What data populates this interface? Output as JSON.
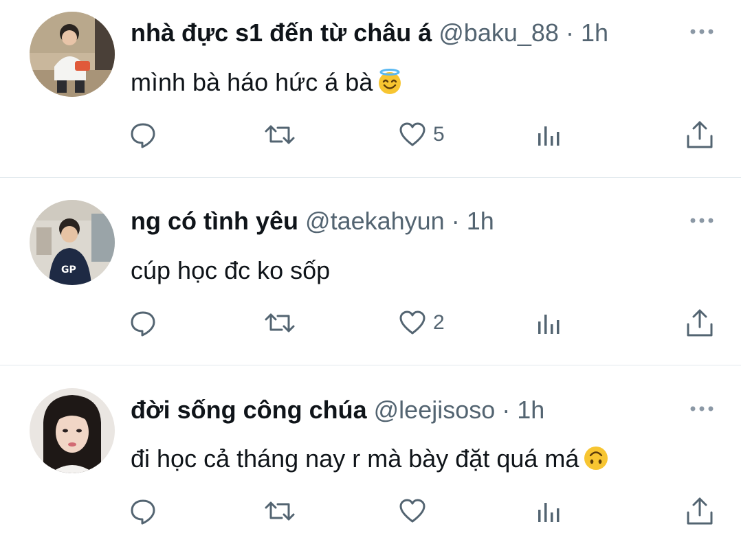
{
  "tweets": [
    {
      "name": "nhà đực s1 đến từ châu á",
      "handle": "@baku_88",
      "separator": "·",
      "time": "1h",
      "text": "mình bà háo hức á bà",
      "emoji": "smiling-face-with-halo",
      "likes": "5"
    },
    {
      "name": "ng có tình yêu",
      "handle": "@taekahyun",
      "separator": "·",
      "time": "1h",
      "text": "cúp học đc ko sốp",
      "emoji": "",
      "likes": "2"
    },
    {
      "name": "đời sống công chúa",
      "handle": "@leejisoso",
      "separator": "·",
      "time": "1h",
      "text": "đi học cả tháng nay r mà bày đặt quá má",
      "emoji": "upside-down-face",
      "likes": ""
    }
  ],
  "icons": {
    "more": "ellipsis-icon",
    "reply": "reply-icon",
    "retweet": "retweet-icon",
    "like": "heart-icon",
    "views": "views-chart-icon",
    "share": "share-icon"
  },
  "colors": {
    "text": "#0f1419",
    "secondary": "#536471",
    "divider": "#e1e8ed"
  }
}
